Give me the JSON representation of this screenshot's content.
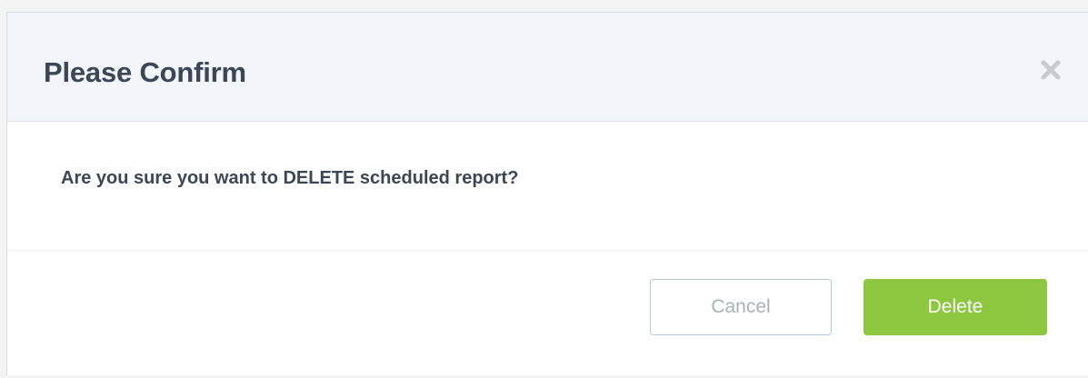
{
  "dialog": {
    "title": "Please Confirm",
    "close_icon": "close-x-icon",
    "message": "Are you sure you want to DELETE scheduled report?",
    "cancel_label": "Cancel",
    "delete_label": "Delete"
  },
  "colors": {
    "title_text": "#3b4656",
    "header_background": "#f2f5f9",
    "delete_button": "#8dc63f",
    "cancel_border": "#b9c9d6",
    "cancel_text": "#a7b1ba"
  }
}
